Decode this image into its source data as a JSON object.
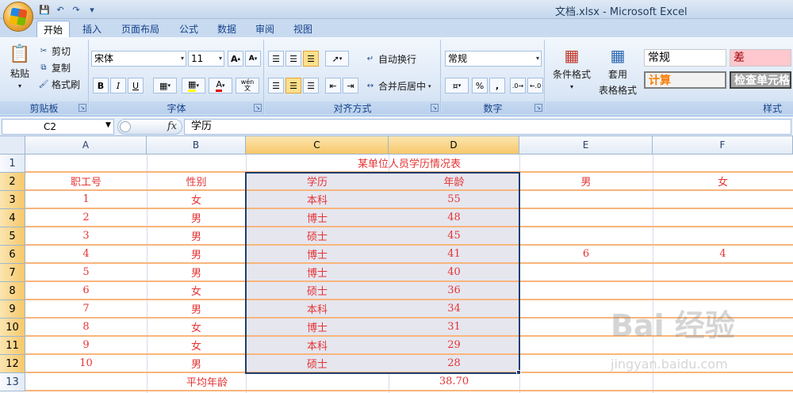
{
  "window": {
    "title": "文档.xlsx - Microsoft Excel"
  },
  "tabs": [
    "开始",
    "插入",
    "页面布局",
    "公式",
    "数据",
    "审阅",
    "视图"
  ],
  "ribbon": {
    "clipboard": {
      "paste": "粘贴",
      "cut": "剪切",
      "copy": "复制",
      "format_painter": "格式刷",
      "label": "剪贴板"
    },
    "font": {
      "name": "宋体",
      "size": "11",
      "label": "字体",
      "bold": "B",
      "italic": "I",
      "underline": "U",
      "font_color_glyph": "A",
      "grow_glyph": "A",
      "shrink_glyph": "A",
      "wen": "wén",
      "wen2": "文"
    },
    "alignment": {
      "wrap": "自动换行",
      "merge": "合并后居中",
      "label": "对齐方式"
    },
    "number": {
      "format": "常规",
      "percent": "%",
      "comma": ",",
      "label": "数字"
    },
    "styles": {
      "conditional": "条件格式",
      "table_format_1": "套用",
      "table_format_2": "表格格式",
      "normal": "常规",
      "bad": "差",
      "calc": "计算",
      "check": "检查单元格",
      "label": "样式"
    }
  },
  "formula_bar": {
    "name_box": "C2",
    "fx": "fx",
    "content": "学历"
  },
  "columns": [
    "A",
    "B",
    "C",
    "D",
    "E",
    "F"
  ],
  "rows": [
    "1",
    "2",
    "3",
    "4",
    "5",
    "6",
    "7",
    "8",
    "9",
    "10",
    "11",
    "12",
    "13"
  ],
  "sheet": {
    "title": "某单位人员学历情况表",
    "headers": [
      "职工号",
      "性别",
      "学历",
      "年龄",
      "男",
      "女"
    ],
    "data": [
      [
        "1",
        "女",
        "本科",
        "55",
        "",
        ""
      ],
      [
        "2",
        "男",
        "博士",
        "48",
        "",
        ""
      ],
      [
        "3",
        "男",
        "硕士",
        "45",
        "",
        ""
      ],
      [
        "4",
        "男",
        "博士",
        "41",
        "6",
        "4"
      ],
      [
        "5",
        "男",
        "博士",
        "40",
        "",
        ""
      ],
      [
        "6",
        "女",
        "硕士",
        "36",
        "",
        ""
      ],
      [
        "7",
        "男",
        "本科",
        "34",
        "",
        ""
      ],
      [
        "8",
        "女",
        "博士",
        "31",
        "",
        ""
      ],
      [
        "9",
        "女",
        "本科",
        "29",
        "",
        ""
      ],
      [
        "10",
        "男",
        "硕士",
        "28",
        "",
        ""
      ]
    ],
    "avg_label": "平均年龄",
    "avg_value": "38.70"
  },
  "watermark": {
    "main": "Bai 经验",
    "sub": "jingyan.baidu.com"
  }
}
